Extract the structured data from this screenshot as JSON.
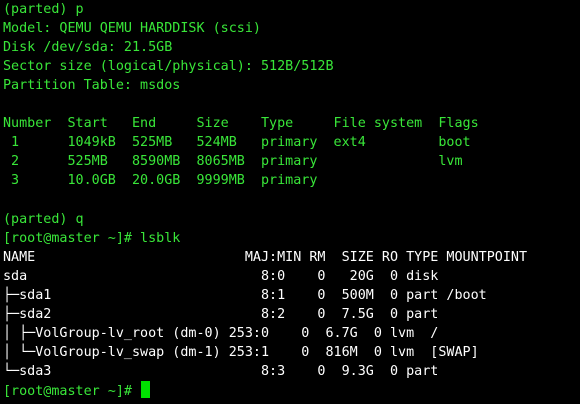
{
  "accent_color": "#39e639",
  "cursor_color": "#00e000",
  "terminal": {
    "lines": [
      {
        "text": "(parted) p",
        "color": "green"
      },
      {
        "text": "Model: QEMU QEMU HARDDISK (scsi)",
        "color": "green"
      },
      {
        "text": "Disk /dev/sda: 21.5GB",
        "color": "green"
      },
      {
        "text": "Sector size (logical/physical): 512B/512B",
        "color": "green"
      },
      {
        "text": "Partition Table: msdos",
        "color": "green"
      },
      {
        "text": "",
        "color": "green"
      },
      {
        "text": "Number  Start   End     Size    Type     File system  Flags",
        "color": "green"
      },
      {
        "text": " 1      1049kB  525MB   524MB   primary  ext4         boot",
        "color": "green"
      },
      {
        "text": " 2      525MB   8590MB  8065MB  primary               lvm",
        "color": "green"
      },
      {
        "text": " 3      10.0GB  20.0GB  9999MB  primary",
        "color": "green"
      },
      {
        "text": "",
        "color": "green"
      },
      {
        "text": "(parted) q",
        "color": "green"
      },
      {
        "text": "[root@master ~]# lsblk",
        "color": "green"
      },
      {
        "text": "NAME                          MAJ:MIN RM  SIZE RO TYPE MOUNTPOINT",
        "color": "white"
      },
      {
        "text": "sda                             8:0    0   20G  0 disk",
        "color": "white"
      },
      {
        "text": "├─sda1                          8:1    0  500M  0 part /boot",
        "color": "white"
      },
      {
        "text": "├─sda2                          8:2    0  7.5G  0 part",
        "color": "white"
      },
      {
        "text": "│ ├─VolGroup-lv_root (dm-0) 253:0    0  6.7G  0 lvm  /",
        "color": "white"
      },
      {
        "text": "│ └─VolGroup-lv_swap (dm-1) 253:1    0  816M  0 lvm  [SWAP]",
        "color": "white"
      },
      {
        "text": "└─sda3                          8:3    0  9.3G  0 part",
        "color": "white"
      }
    ],
    "prompt": "[root@master ~]# "
  }
}
